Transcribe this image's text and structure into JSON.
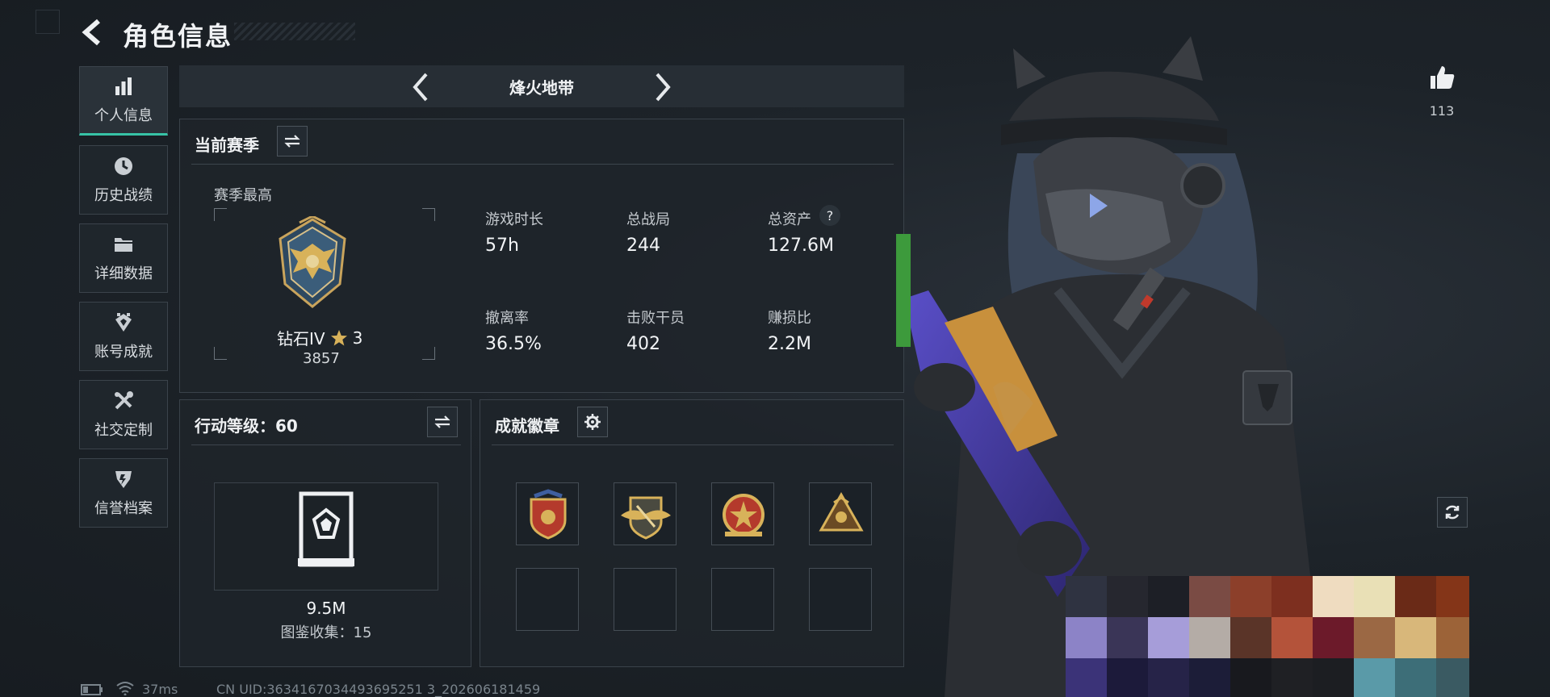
{
  "header": {
    "title": "角色信息"
  },
  "sidebar": {
    "items": [
      {
        "label": "个人信息",
        "icon": "bar-chart-icon",
        "active": true
      },
      {
        "label": "历史战绩",
        "icon": "history-clock-icon"
      },
      {
        "label": "详细数据",
        "icon": "folder-icon"
      },
      {
        "label": "账号成就",
        "icon": "achievement-icon"
      },
      {
        "label": "社交定制",
        "icon": "tools-icon"
      },
      {
        "label": "信誉档案",
        "icon": "credit-shield-icon"
      }
    ]
  },
  "zone": {
    "name": "烽火地带"
  },
  "season": {
    "title": "当前赛季",
    "best_label": "赛季最高",
    "rank_name": "钻石IV",
    "rank_stars": "3",
    "rank_points": "3857",
    "stats": [
      {
        "label": "游戏时长",
        "value": "57h"
      },
      {
        "label": "总战局",
        "value": "244"
      },
      {
        "label": "总资产",
        "value": "127.6M",
        "help": "?"
      },
      {
        "label": "撤离率",
        "value": "36.5%"
      },
      {
        "label": "击败干员",
        "value": "402"
      },
      {
        "label": "赚损比",
        "value": "2.2M"
      }
    ]
  },
  "action_level": {
    "title": "行动等级：60",
    "value": "9.5M",
    "collection": "图鉴收集：15"
  },
  "achievements": {
    "title": "成就徽章",
    "badges": [
      "red-shield-badge-icon",
      "gold-wings-badge-icon",
      "red-star-badge-icon",
      "gold-triangle-badge-icon"
    ]
  },
  "likes": {
    "count": "113"
  },
  "status": {
    "ping": "37ms",
    "uid": "CN UID:3634167034493695251 3_202606181459"
  },
  "colors": {
    "accent": "#37c3a6",
    "gold": "#d8b25a",
    "bg": "#1b2127"
  }
}
